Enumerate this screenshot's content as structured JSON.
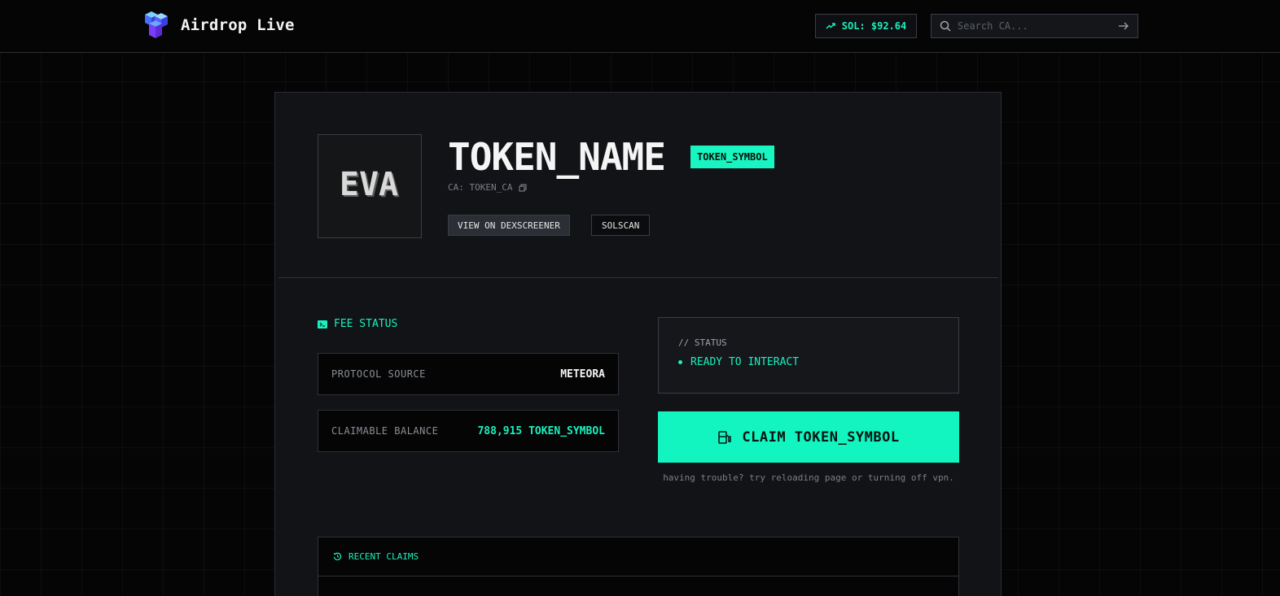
{
  "header": {
    "brand": "Airdrop Live",
    "sol_price": "SOL: $92.64",
    "search_placeholder": "Search CA..."
  },
  "token": {
    "logo_text": "EVA",
    "name": "TOKEN_NAME",
    "symbol": "TOKEN_SYMBOL",
    "ca": "CA: TOKEN_CA",
    "dexscreener_label": "VIEW ON DEXSCREENER",
    "solscan_label": "SOLSCAN"
  },
  "fee_status": {
    "heading": "FEE STATUS",
    "protocol_label": "PROTOCOL SOURCE",
    "protocol_value": "METEORA",
    "balance_label": "CLAIMABLE BALANCE",
    "balance_value": "788,915 TOKEN_SYMBOL"
  },
  "status": {
    "caption": "// STATUS",
    "state": "READY TO INTERACT"
  },
  "claim": {
    "label": "CLAIM TOKEN_SYMBOL",
    "help": "having trouble? try reloading page or turning off vpn."
  },
  "recent": {
    "heading": "RECENT CLAIMS"
  },
  "colors": {
    "accent": "#19f0bd",
    "background": "#050505",
    "card": "#111317"
  }
}
